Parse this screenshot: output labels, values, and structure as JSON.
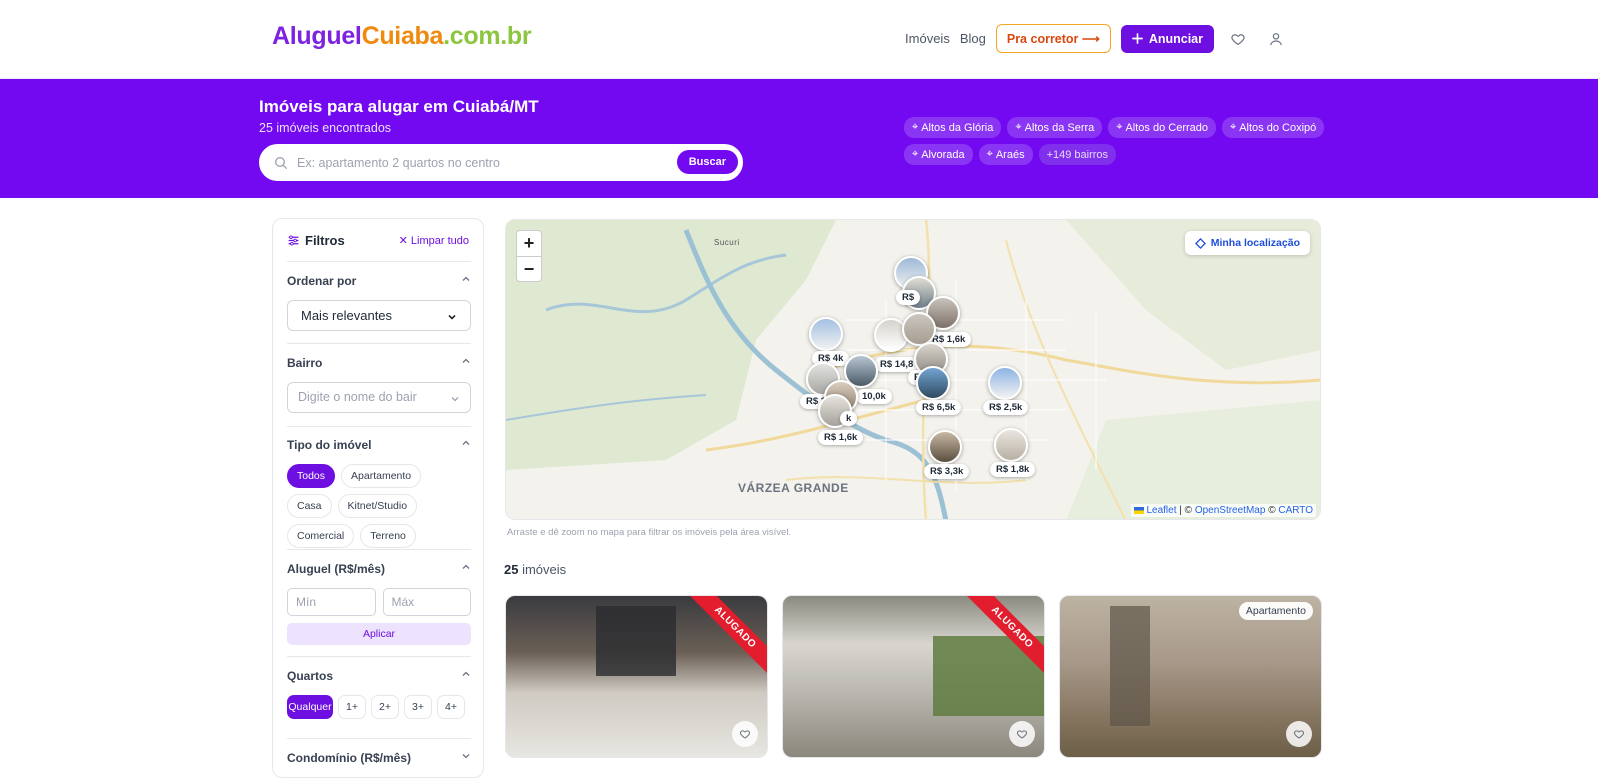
{
  "header": {
    "logo": {
      "part1": "Aluguel",
      "part2": "Cuiaba",
      "part3": ".com.br"
    },
    "nav": {
      "imoveis": "Imóveis",
      "blog": "Blog",
      "corretor": "Pra corretor ⟶",
      "anunciar": "Anunciar"
    },
    "icons": [
      "heart-icon",
      "user-icon"
    ]
  },
  "hero": {
    "title": "Imóveis para alugar em Cuiabá/MT",
    "count": "25 imóveis encontrados",
    "search": {
      "placeholder": "Ex: apartamento 2 quartos no centro",
      "button": "Buscar"
    },
    "chips": [
      "Altos da Glória",
      "Altos da Serra",
      "Altos do Cerrado",
      "Altos do Coxipó",
      "Alvorada",
      "Araés"
    ],
    "more_chip": "+149 bairros"
  },
  "filters": {
    "title": "Filtros",
    "clear": "Limpar tudo",
    "ordenar": {
      "label": "Ordenar por",
      "value": "Mais relevantes"
    },
    "bairro": {
      "label": "Bairro",
      "placeholder": "Digite o nome do bair"
    },
    "tipo": {
      "label": "Tipo do imóvel",
      "options": [
        "Todos",
        "Apartamento",
        "Casa",
        "Kitnet/Studio",
        "Comercial",
        "Terreno"
      ],
      "selected": "Todos"
    },
    "aluguel": {
      "label": "Aluguel (R$/mês)",
      "min": "Mín",
      "max": "Máx",
      "apply": "Aplicar"
    },
    "quartos": {
      "label": "Quartos",
      "options": [
        "Qualquer",
        "1+",
        "2+",
        "3+",
        "4+"
      ],
      "selected": "Qualquer"
    },
    "condominio": {
      "label": "Condomínio (R$/mês)"
    }
  },
  "map": {
    "zoom_in": "+",
    "zoom_out": "−",
    "locate": "Minha localização",
    "attribution": {
      "leaflet": "Leaflet",
      "sep1": " | © ",
      "osm": "OpenStreetMap",
      "sep2": " © ",
      "carto": "CARTO"
    },
    "labels": {
      "city": "VÁRZEA GRANDE",
      "sucuri": "Sucuri"
    },
    "price_markers": [
      "R$ 1,6k",
      "R$ 4k",
      "R$ 14,8",
      "10,0k",
      "R$ 6,5k",
      "R$ 2,5k",
      "R$ 3",
      "R$ 1,6k",
      "R$ 3,3k",
      "R$ 1,8k",
      "R$",
      "R$",
      "k"
    ],
    "hint": "Arraste e dê zoom no mapa para filtrar os imóveis pela área visível."
  },
  "results": {
    "count": "25",
    "label": "imóveis"
  },
  "cards": [
    {
      "ribbon": "ALUGADO",
      "badge": "",
      "colors": [
        "#c9c2b8",
        "#e3e1dc",
        "#3a3b3f"
      ]
    },
    {
      "ribbon": "ALUGADO",
      "badge": "",
      "colors": [
        "#b7b3a8",
        "#d9d7d0",
        "#6f8a4a"
      ]
    },
    {
      "ribbon": "",
      "badge": "Apartamento",
      "colors": [
        "#a89a86",
        "#cfc6b8",
        "#6d5e48"
      ]
    }
  ],
  "colors": {
    "brand": "#7209f0",
    "accent": "#f08a0e",
    "green": "#8cc63f",
    "ribbon": "#e11d2e"
  }
}
